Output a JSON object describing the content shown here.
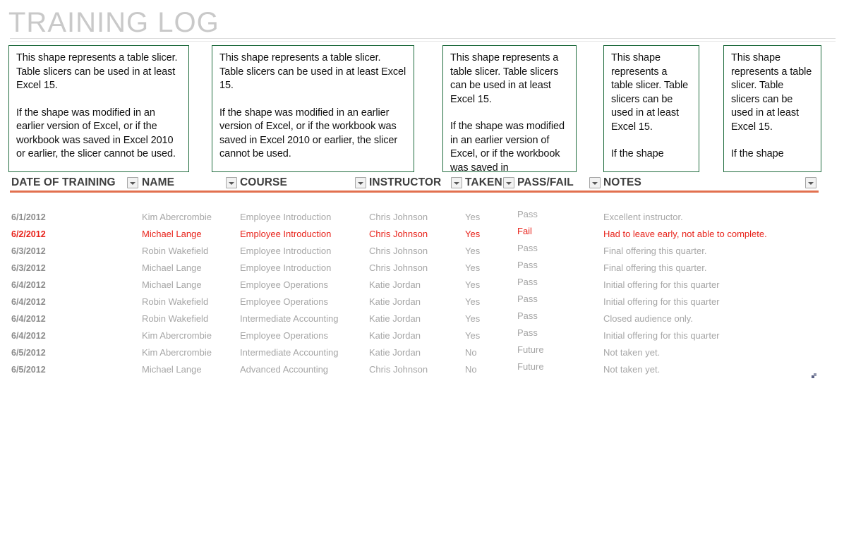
{
  "page": {
    "title": "TRAINING LOG"
  },
  "slicer_notes": [
    {
      "name": "slicer-note-1",
      "para1": "This shape represents a table slicer. Table slicers can be used in at least Excel 15.",
      "para2": "If the shape was modified in an earlier version of Excel, or if the workbook was saved in Excel 2010 or earlier, the slicer cannot be used."
    },
    {
      "name": "slicer-note-2",
      "para1": "This shape represents a table slicer. Table slicers can be used in at least Excel 15.",
      "para2": "If the shape was modified in an earlier version of Excel, or if the workbook was saved in Excel 2010 or earlier, the slicer cannot be used."
    },
    {
      "name": "slicer-note-3",
      "para1": "This shape represents a table slicer. Table slicers can be used in at least Excel 15.",
      "para2": "If the shape was modified in an earlier version of Excel, or if the workbook was saved in"
    },
    {
      "name": "slicer-note-4",
      "para1": "This shape represents a table slicer. Table slicers can be used in at least Excel 15.",
      "para2": "If the shape"
    },
    {
      "name": "slicer-note-5",
      "para1": "This shape represents a table slicer. Table slicers can be used in at least Excel 15.",
      "para2": "If the shape"
    }
  ],
  "table": {
    "columns": [
      {
        "key": "date",
        "label": "DATE OF TRAINING"
      },
      {
        "key": "name",
        "label": "NAME"
      },
      {
        "key": "course",
        "label": "COURSE"
      },
      {
        "key": "instructor",
        "label": "INSTRUCTOR"
      },
      {
        "key": "taken",
        "label": "TAKEN"
      },
      {
        "key": "passfail",
        "label": "PASS/FAIL"
      },
      {
        "key": "notes",
        "label": "NOTES"
      }
    ],
    "filter_icon": "filter-dropdown-icon",
    "rows": [
      {
        "date": "6/1/2012",
        "name": "Kim Abercrombie",
        "course": "Employee Introduction",
        "instructor": "Chris Johnson",
        "taken": "Yes",
        "passfail": "Pass",
        "notes": "Excellent instructor.",
        "alert": false
      },
      {
        "date": "6/2/2012",
        "name": "Michael Lange",
        "course": "Employee Introduction",
        "instructor": "Chris Johnson",
        "taken": "Yes",
        "passfail": "Fail",
        "notes": "Had to leave early, not able to complete.",
        "alert": true
      },
      {
        "date": "6/3/2012",
        "name": "Robin Wakefield",
        "course": "Employee Introduction",
        "instructor": "Chris Johnson",
        "taken": "Yes",
        "passfail": "Pass",
        "notes": "Final offering this quarter.",
        "alert": false
      },
      {
        "date": "6/3/2012",
        "name": "Michael Lange",
        "course": "Employee Introduction",
        "instructor": "Chris Johnson",
        "taken": "Yes",
        "passfail": "Pass",
        "notes": "Final offering this quarter.",
        "alert": false
      },
      {
        "date": "6/4/2012",
        "name": "Michael Lange",
        "course": "Employee Operations",
        "instructor": "Katie Jordan",
        "taken": "Yes",
        "passfail": "Pass",
        "notes": "Initial offering for this quarter",
        "alert": false
      },
      {
        "date": "6/4/2012",
        "name": "Robin Wakefield",
        "course": "Employee Operations",
        "instructor": "Katie Jordan",
        "taken": "Yes",
        "passfail": "Pass",
        "notes": "Initial offering for this quarter",
        "alert": false
      },
      {
        "date": "6/4/2012",
        "name": "Robin Wakefield",
        "course": "Intermediate Accounting",
        "instructor": "Katie Jordan",
        "taken": "Yes",
        "passfail": "Pass",
        "notes": "Closed audience only.",
        "alert": false
      },
      {
        "date": "6/4/2012",
        "name": "Kim Abercrombie",
        "course": "Employee Operations",
        "instructor": "Katie Jordan",
        "taken": "Yes",
        "passfail": "Pass",
        "notes": "Initial offering for this quarter",
        "alert": false
      },
      {
        "date": "6/5/2012",
        "name": "Kim Abercrombie",
        "course": "Intermediate Accounting",
        "instructor": "Katie Jordan",
        "taken": "No",
        "passfail": "Future",
        "notes": "Not taken yet.",
        "alert": false
      },
      {
        "date": "6/5/2012",
        "name": "Michael Lange",
        "course": "Advanced Accounting",
        "instructor": "Chris Johnson",
        "taken": "No",
        "passfail": "Future",
        "notes": "Not taken yet.",
        "alert": false
      }
    ],
    "resize_handle": "table-resize-handle"
  },
  "colors": {
    "accent_rule": "#e2704f",
    "slicer_border": "#1f6b3d",
    "alert_text": "#e8231b",
    "title_text": "#c9c9c9",
    "body_text": "#a6a6a6"
  }
}
